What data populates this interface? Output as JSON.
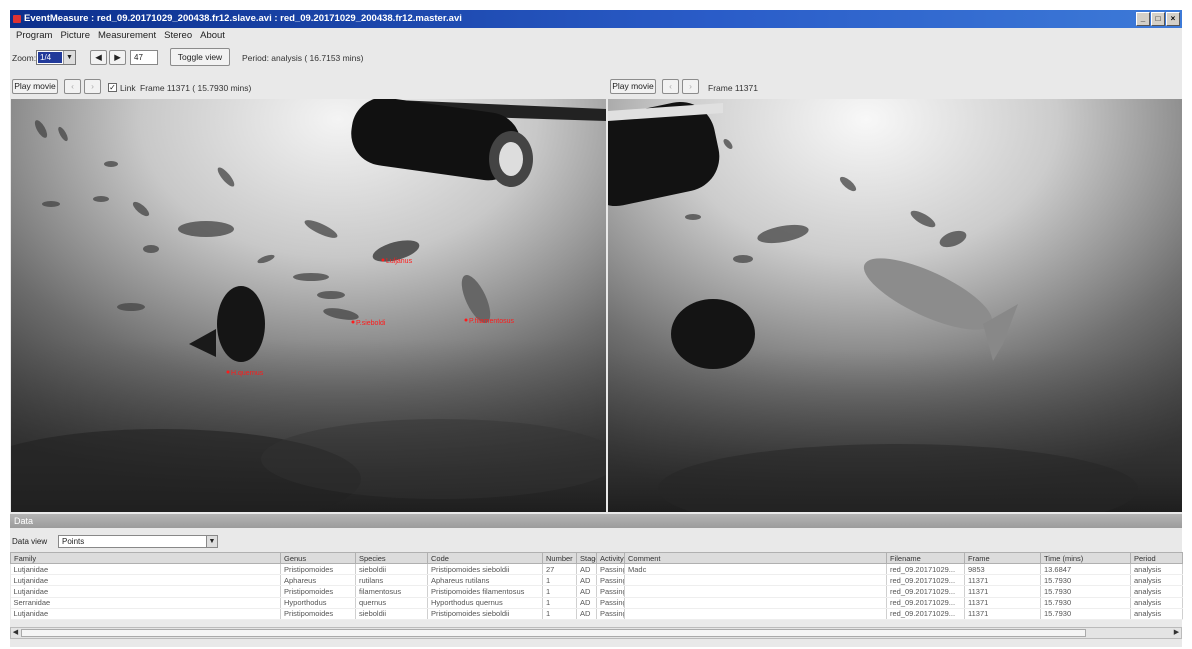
{
  "window": {
    "title": "EventMeasure : red_09.20171029_200438.fr12.slave.avi : red_09.20171029_200438.fr12.master.avi"
  },
  "menu": [
    "Program",
    "Picture",
    "Measurement",
    "Stereo",
    "About"
  ],
  "toolbar": {
    "zoom_label": "Zoom:",
    "zoom_value": "1/4",
    "frame_step": "47",
    "toggle_view": "Toggle view",
    "period": "Period: analysis ( 16.7153 mins)"
  },
  "left_view": {
    "play_label": "Play movie",
    "link_label": "Link",
    "frame_text": "Frame 11371 ( 15.7930 mins)",
    "link_checked": true,
    "annotations": [
      {
        "label": "Luljanus"
      },
      {
        "label": "P.sieboldi"
      },
      {
        "label": "P.filamentosus"
      },
      {
        "label": "H.quernus"
      }
    ]
  },
  "right_view": {
    "play_label": "Play movie",
    "frame_text": "Frame 11371"
  },
  "data_panel": {
    "title": "Data",
    "data_view_label": "Data view",
    "data_view_value": "Points",
    "columns": [
      "Family",
      "Genus",
      "Species",
      "Code",
      "Number",
      "Stage",
      "Activity",
      "Comment",
      "Filename",
      "Frame",
      "Time (mins)",
      "Period"
    ],
    "rows": [
      [
        "Lutjanidae",
        "Pristipomoides",
        "sieboldii",
        "Pristipomoides sieboldii",
        "27",
        "AD",
        "Passing",
        "Madc",
        "red_09.20171029...",
        "9853",
        "13.6847",
        "analysis"
      ],
      [
        "Lutjanidae",
        "Aphareus",
        "rutilans",
        "Aphareus rutilans",
        "1",
        "AD",
        "Passing",
        "",
        "red_09.20171029...",
        "11371",
        "15.7930",
        "analysis"
      ],
      [
        "Lutjanidae",
        "Pristipomoides",
        "filamentosus",
        "Pristipomoides filamentosus",
        "1",
        "AD",
        "Passing",
        "",
        "red_09.20171029...",
        "11371",
        "15.7930",
        "analysis"
      ],
      [
        "Serranidae",
        "Hyporthodus",
        "quernus",
        "Hyporthodus quernus",
        "1",
        "AD",
        "Passing",
        "",
        "red_09.20171029...",
        "11371",
        "15.7930",
        "analysis"
      ],
      [
        "Lutjanidae",
        "Pristipomoides",
        "sieboldii",
        "Pristipomoides sieboldii",
        "1",
        "AD",
        "Passing",
        "",
        "red_09.20171029...",
        "11371",
        "15.7930",
        "analysis"
      ]
    ]
  },
  "colors": {
    "annotation": "#ff1a1a",
    "titlebar": "#1b4bb0"
  }
}
